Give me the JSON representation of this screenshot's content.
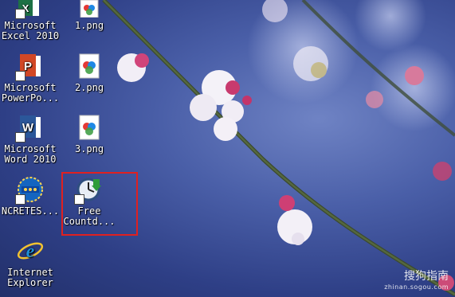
{
  "desktop": {
    "icons": [
      {
        "label": "Microsoft\nExcel 2010",
        "icon": "excel-icon"
      },
      {
        "label": "1.png",
        "icon": "png-file-icon"
      },
      {
        "label": "Microsoft\nPowerPo...",
        "icon": "powerpoint-icon"
      },
      {
        "label": "2.png",
        "icon": "png-file-icon"
      },
      {
        "label": "Microsoft\nWord 2010",
        "icon": "word-icon"
      },
      {
        "label": "3.png",
        "icon": "png-file-icon"
      },
      {
        "label": "NCRETES...",
        "icon": "ncretes-icon"
      },
      {
        "label": "Free\nCountd...",
        "icon": "free-countdown-icon",
        "selected": true
      },
      {
        "label": "Internet\nExplorer",
        "icon": "internet-explorer-icon"
      }
    ]
  },
  "watermark": {
    "text": "搜狗指南",
    "url": "zhinan.sogou.com"
  },
  "colors": {
    "highlight": "#e02020",
    "excel": "#1e7145",
    "powerpoint": "#d24726",
    "word": "#2b579a",
    "ie": "#1e8fd6"
  }
}
